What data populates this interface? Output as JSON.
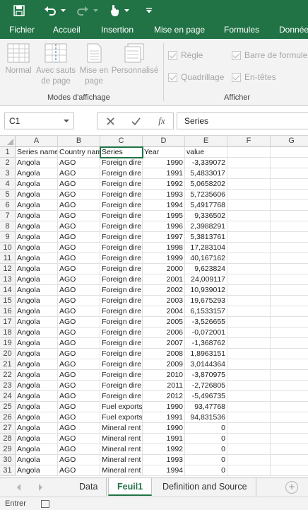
{
  "qat": {
    "icons": [
      "save-icon",
      "undo-icon",
      "redo-icon",
      "touch-mode-icon",
      "customize-icon"
    ]
  },
  "ribbon": {
    "tabs": [
      "Fichier",
      "Accueil",
      "Insertion",
      "Mise en page",
      "Formules",
      "Donnée"
    ],
    "buttons": {
      "normal": "Normal",
      "page_break": "Avec sauts de page",
      "page_layout": "Mise en page",
      "custom": "Personnalisé"
    },
    "group_views": "Modes d'affichage",
    "group_show": "Afficher",
    "checks": {
      "ruler": "Règle",
      "formula_bar": "Barre de formule",
      "gridlines": "Quadrillage",
      "headings": "En-têtes"
    }
  },
  "formula_bar": {
    "name_box": "C1",
    "fx": "fx",
    "content": "Series"
  },
  "columns": [
    "A",
    "B",
    "C",
    "D",
    "E",
    "F",
    "G"
  ],
  "header_row": [
    "Series name",
    "Country nam",
    "Series",
    "Year",
    "value"
  ],
  "rows": [
    [
      "Angola",
      "AGO",
      "Foreign dire",
      "1990",
      "-3,339072"
    ],
    [
      "Angola",
      "AGO",
      "Foreign dire",
      "1991",
      "5,4833017"
    ],
    [
      "Angola",
      "AGO",
      "Foreign dire",
      "1992",
      "5,0658202"
    ],
    [
      "Angola",
      "AGO",
      "Foreign dire",
      "1993",
      "5,7235606"
    ],
    [
      "Angola",
      "AGO",
      "Foreign dire",
      "1994",
      "5,4917768"
    ],
    [
      "Angola",
      "AGO",
      "Foreign dire",
      "1995",
      "9,336502"
    ],
    [
      "Angola",
      "AGO",
      "Foreign dire",
      "1996",
      "2,3988291"
    ],
    [
      "Angola",
      "AGO",
      "Foreign dire",
      "1997",
      "5,3813761"
    ],
    [
      "Angola",
      "AGO",
      "Foreign dire",
      "1998",
      "17,283104"
    ],
    [
      "Angola",
      "AGO",
      "Foreign dire",
      "1999",
      "40,167162"
    ],
    [
      "Angola",
      "AGO",
      "Foreign dire",
      "2000",
      "9,623824"
    ],
    [
      "Angola",
      "AGO",
      "Foreign dire",
      "2001",
      "24,009117"
    ],
    [
      "Angola",
      "AGO",
      "Foreign dire",
      "2002",
      "10,939012"
    ],
    [
      "Angola",
      "AGO",
      "Foreign dire",
      "2003",
      "19,675293"
    ],
    [
      "Angola",
      "AGO",
      "Foreign dire",
      "2004",
      "6,1533157"
    ],
    [
      "Angola",
      "AGO",
      "Foreign dire",
      "2005",
      "-3,526655"
    ],
    [
      "Angola",
      "AGO",
      "Foreign dire",
      "2006",
      "-0,072001"
    ],
    [
      "Angola",
      "AGO",
      "Foreign dire",
      "2007",
      "-1,368762"
    ],
    [
      "Angola",
      "AGO",
      "Foreign dire",
      "2008",
      "1,8963151"
    ],
    [
      "Angola",
      "AGO",
      "Foreign dire",
      "2009",
      "3,0144364"
    ],
    [
      "Angola",
      "AGO",
      "Foreign dire",
      "2010",
      "-3,870975"
    ],
    [
      "Angola",
      "AGO",
      "Foreign dire",
      "2011",
      "-2,726805"
    ],
    [
      "Angola",
      "AGO",
      "Foreign dire",
      "2012",
      "-5,496735"
    ],
    [
      "Angola",
      "AGO",
      "Fuel exports",
      "1990",
      "93,47768"
    ],
    [
      "Angola",
      "AGO",
      "Fuel exports",
      "1991",
      "94,831536"
    ],
    [
      "Angola",
      "AGO",
      "Mineral rent",
      "1990",
      "0"
    ],
    [
      "Angola",
      "AGO",
      "Mineral rent",
      "1991",
      "0"
    ],
    [
      "Angola",
      "AGO",
      "Mineral rent",
      "1992",
      "0"
    ],
    [
      "Angola",
      "AGO",
      "Mineral rent",
      "1993",
      "0"
    ],
    [
      "Angola",
      "AGO",
      "Mineral rent",
      "1994",
      "0"
    ]
  ],
  "sheets": [
    {
      "label": "Data",
      "active": false
    },
    {
      "label": "Feuil1",
      "active": true
    },
    {
      "label": "Definition and Source",
      "active": false
    }
  ],
  "status": {
    "mode": "Entrer"
  }
}
